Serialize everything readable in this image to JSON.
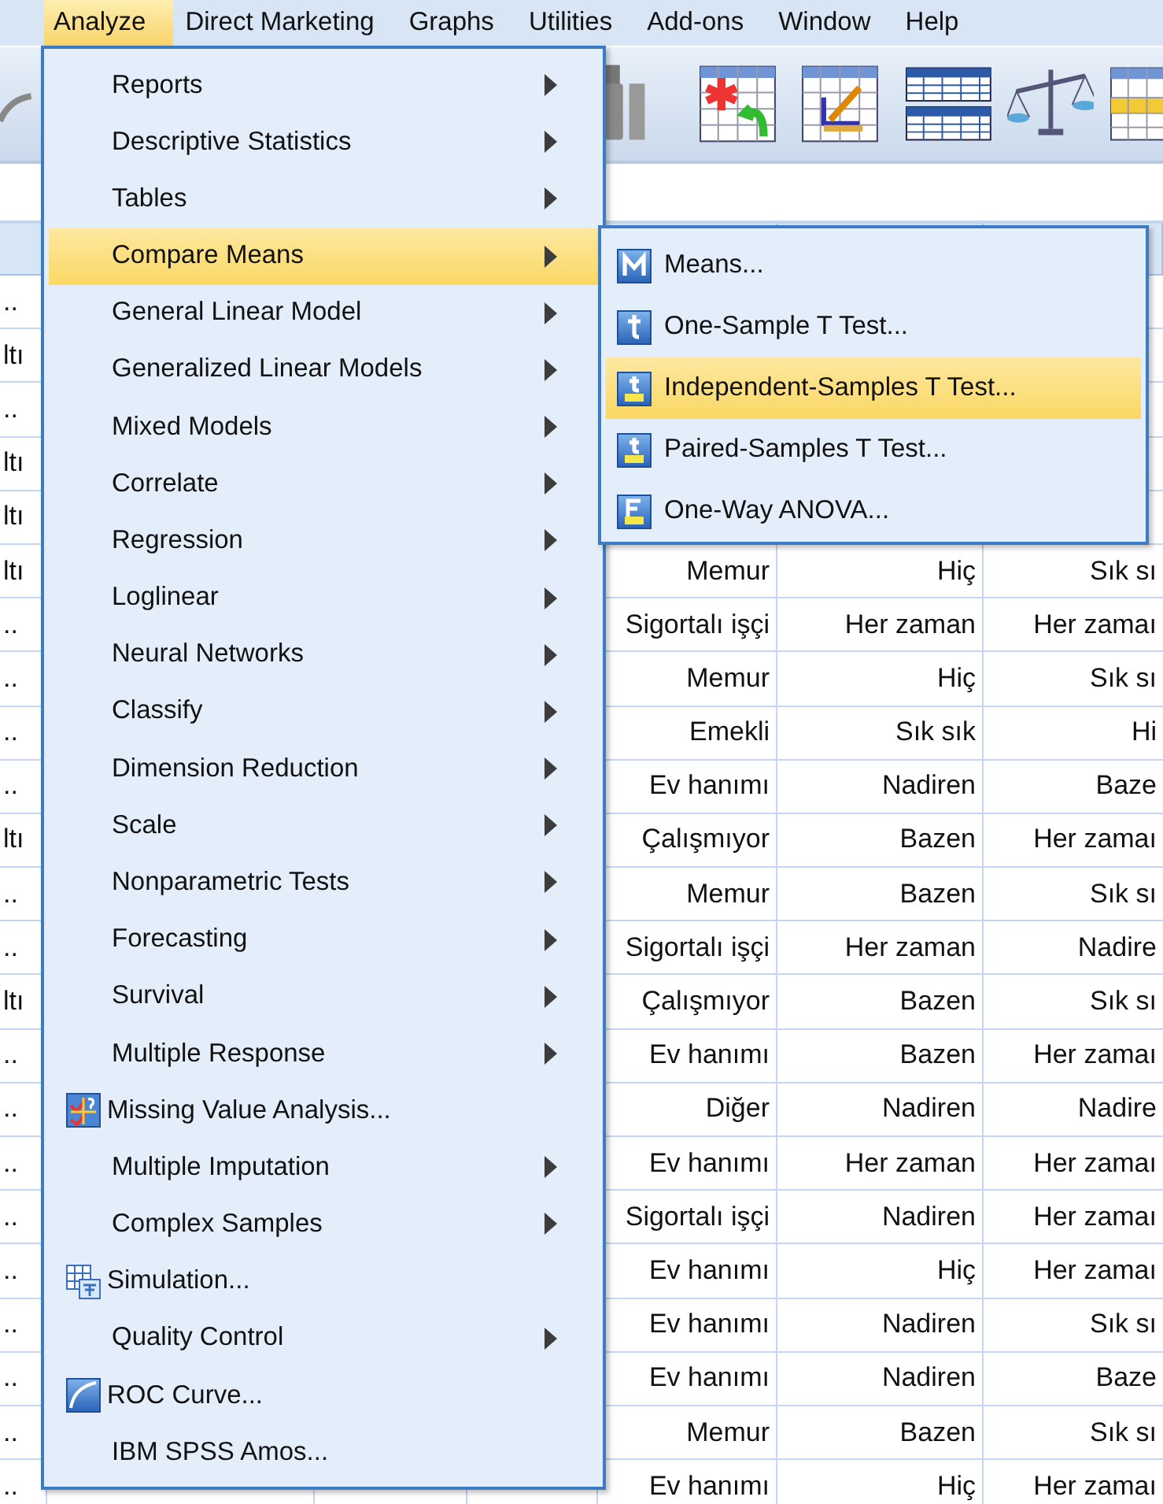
{
  "menu_bar": [
    {
      "label": "Analyze",
      "selected": true
    },
    {
      "label": "Direct Marketing",
      "selected": false
    },
    {
      "label": "Graphs",
      "selected": false
    },
    {
      "label": "Utilities",
      "selected": false
    },
    {
      "label": "Add-ons",
      "selected": false
    },
    {
      "label": "Window",
      "selected": false
    },
    {
      "label": "Help",
      "selected": false
    }
  ],
  "analyze_menu": {
    "items": [
      {
        "label": "Reports",
        "kind": "submenu",
        "selected": false
      },
      {
        "label": "Descriptive Statistics",
        "kind": "submenu",
        "selected": false
      },
      {
        "label": "Tables",
        "kind": "submenu",
        "selected": false
      },
      {
        "label": "Compare Means",
        "kind": "submenu",
        "selected": true
      },
      {
        "label": "General Linear Model",
        "kind": "submenu",
        "selected": false
      },
      {
        "label": "Generalized Linear Models",
        "kind": "submenu",
        "selected": false
      },
      {
        "label": "Mixed Models",
        "kind": "submenu",
        "selected": false
      },
      {
        "label": "Correlate",
        "kind": "submenu",
        "selected": false
      },
      {
        "label": "Regression",
        "kind": "submenu",
        "selected": false
      },
      {
        "label": "Loglinear",
        "kind": "submenu",
        "selected": false
      },
      {
        "label": "Neural Networks",
        "kind": "submenu",
        "selected": false
      },
      {
        "label": "Classify",
        "kind": "submenu",
        "selected": false
      },
      {
        "label": "Dimension Reduction",
        "kind": "submenu",
        "selected": false
      },
      {
        "label": "Scale",
        "kind": "submenu",
        "selected": false
      },
      {
        "label": "Nonparametric Tests",
        "kind": "submenu",
        "selected": false
      },
      {
        "label": "Forecasting",
        "kind": "submenu",
        "selected": false
      },
      {
        "label": "Survival",
        "kind": "submenu",
        "selected": false
      },
      {
        "label": "Multiple Response",
        "kind": "submenu",
        "selected": false
      },
      {
        "label": "Missing Value Analysis...",
        "kind": "checkchart",
        "selected": false
      },
      {
        "label": "Multiple Imputation",
        "kind": "submenu",
        "selected": false
      },
      {
        "label": "Complex Samples",
        "kind": "submenu",
        "selected": false
      },
      {
        "label": "Simulation...",
        "kind": "gridsheet",
        "selected": false
      },
      {
        "label": "Quality Control",
        "kind": "submenu",
        "selected": false
      },
      {
        "label": "ROC Curve...",
        "kind": "curve",
        "selected": false
      },
      {
        "label": "IBM SPSS Amos...",
        "kind": "plain",
        "selected": false
      }
    ]
  },
  "compare_means_menu": {
    "items": [
      {
        "label": "Means...",
        "kind": "means",
        "selected": false
      },
      {
        "label": "One-Sample T Test...",
        "kind": "onesample",
        "selected": false
      },
      {
        "label": "Independent-Samples T Test...",
        "kind": "independent",
        "selected": true
      },
      {
        "label": "Paired-Samples T Test...",
        "kind": "paired",
        "selected": false
      },
      {
        "label": "One-Way ANOVA...",
        "kind": "anova",
        "selected": false
      }
    ]
  },
  "data_grid": {
    "rows": [
      {
        "cells": [
          "..",
          null,
          null,
          null,
          null,
          null,
          null
        ]
      },
      {
        "cells": [
          "ltı",
          null,
          null,
          null,
          null,
          null,
          null
        ]
      },
      {
        "cells": [
          "..",
          null,
          null,
          null,
          null,
          null,
          null
        ]
      },
      {
        "cells": [
          "ltı",
          null,
          null,
          null,
          null,
          null,
          null
        ]
      },
      {
        "cells": [
          "ltı",
          null,
          null,
          null,
          null,
          null,
          null
        ]
      },
      {
        "cells": [
          "ltı",
          null,
          null,
          null,
          "Memur",
          "Hiç",
          "Sık sı"
        ]
      },
      {
        "cells": [
          "..",
          null,
          null,
          null,
          "Sigortalı işçi",
          "Her zaman",
          "Her zamaı"
        ]
      },
      {
        "cells": [
          "..",
          null,
          null,
          null,
          "Memur",
          "Hiç",
          "Sık sı"
        ]
      },
      {
        "cells": [
          "..",
          null,
          null,
          null,
          "Emekli",
          "Sık sık",
          "Hi"
        ]
      },
      {
        "cells": [
          "..",
          null,
          null,
          null,
          "Ev hanımı",
          "Nadiren",
          "Baze"
        ]
      },
      {
        "cells": [
          "ltı",
          null,
          null,
          null,
          "Çalışmıyor",
          "Bazen",
          "Her zamaı"
        ]
      },
      {
        "cells": [
          "..",
          null,
          null,
          null,
          "Memur",
          "Bazen",
          "Sık sı"
        ]
      },
      {
        "cells": [
          "..",
          null,
          null,
          null,
          "Sigortalı işçi",
          "Her zaman",
          "Nadire"
        ]
      },
      {
        "cells": [
          "ltı",
          null,
          null,
          null,
          "Çalışmıyor",
          "Bazen",
          "Sık sı"
        ]
      },
      {
        "cells": [
          "..",
          null,
          null,
          null,
          "Ev hanımı",
          "Bazen",
          "Her zamaı"
        ]
      },
      {
        "cells": [
          "..",
          null,
          null,
          null,
          "Diğer",
          "Nadiren",
          "Nadire"
        ]
      },
      {
        "cells": [
          "..",
          null,
          null,
          null,
          "Ev hanımı",
          "Her zaman",
          "Her zamaı"
        ]
      },
      {
        "cells": [
          "..",
          null,
          null,
          null,
          "Sigortalı işçi",
          "Nadiren",
          "Her zamaı"
        ]
      },
      {
        "cells": [
          "..",
          null,
          null,
          null,
          "Ev hanımı",
          "Hiç",
          "Her zamaı"
        ]
      },
      {
        "cells": [
          "..",
          null,
          null,
          null,
          "Ev hanımı",
          "Nadiren",
          "Sık sı"
        ]
      },
      {
        "cells": [
          "..",
          null,
          null,
          null,
          "Ev hanımı",
          "Nadiren",
          "Baze"
        ]
      },
      {
        "cells": [
          "..",
          null,
          null,
          null,
          "Memur",
          "Bazen",
          "Sık sı"
        ]
      },
      {
        "cells": [
          "..",
          null,
          null,
          null,
          "Ev hanımı",
          "Hiç",
          "Her zamaı"
        ]
      }
    ]
  }
}
